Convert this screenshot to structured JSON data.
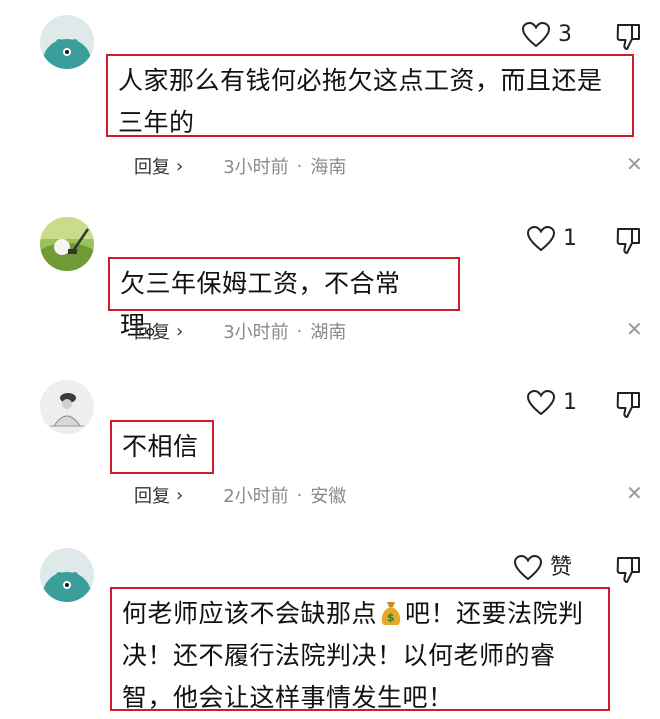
{
  "comments": [
    {
      "like_count": "3",
      "text": "人家那么有钱何必拖欠这点工资，而且还是三年的",
      "reply_label": "回复",
      "time": "3小时前",
      "location": "海南"
    },
    {
      "like_count": "1",
      "text": "欠三年保姆工资，不合常理。",
      "reply_label": "回复",
      "time": "3小时前",
      "location": "湖南"
    },
    {
      "like_count": "1",
      "text": "不相信",
      "reply_label": "回复",
      "time": "2小时前",
      "location": "安徽"
    },
    {
      "like_count": "赞",
      "text_before_emoji": "何老师应该不会缺那点",
      "emoji": "money-bag",
      "text_after_emoji": "吧！还要法院判决！还不履行法院判决！以何老师的睿智，他会让这样事情发生吧！"
    }
  ],
  "separator": "·",
  "close_glyph": "✕",
  "chevron_glyph": "›",
  "colors": {
    "highlight_border": "#d11a2a",
    "meta_text": "#8a8a8a",
    "teal_avatar": "#3a9e9a"
  }
}
